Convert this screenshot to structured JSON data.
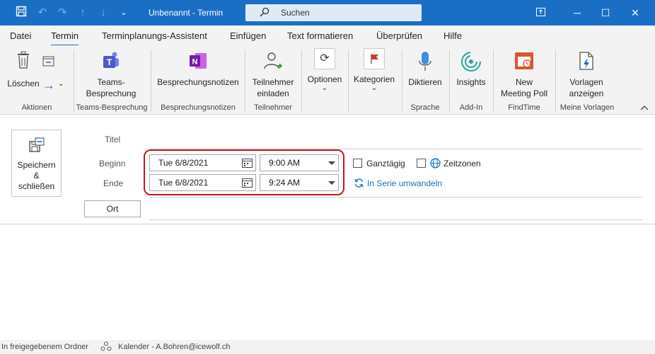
{
  "titlebar": {
    "title": "Unbenannt  -  Termin",
    "search_placeholder": "Suchen"
  },
  "tabs": [
    {
      "label": "Datei"
    },
    {
      "label": "Termin"
    },
    {
      "label": "Terminplanungs-Assistent"
    },
    {
      "label": "Einfügen"
    },
    {
      "label": "Text formatieren"
    },
    {
      "label": "Überprüfen"
    },
    {
      "label": "Hilfe"
    }
  ],
  "ribbon": {
    "buttons": {
      "delete": "Löschen",
      "teams": "Teams-\nBesprechung",
      "notes": "Besprechungsnotizen",
      "attendees": "Teilnehmer\neinladen",
      "options": "Optionen",
      "categories": "Kategorien",
      "dictate": "Diktieren",
      "insights": "Insights",
      "new_poll": "New\nMeeting Poll",
      "templates": "Vorlagen\nanzeigen"
    },
    "groups": {
      "actions": "Aktionen",
      "teams": "Teams-Besprechung",
      "notes": "Besprechungsnotizen",
      "attendees": "Teilnehmer",
      "speech": "Sprache",
      "addin": "Add-In",
      "findtime": "FindTime",
      "templates": "Meine Vorlagen"
    }
  },
  "form": {
    "save_label": "Speichern\n&\nschließen",
    "title_label": "Titel",
    "start_label": "Beginn",
    "end_label": "Ende",
    "start_date": "Tue 6/8/2021",
    "start_time": "9:00 AM",
    "end_date": "Tue 6/8/2021",
    "end_time": "9:24 AM",
    "allday_label": "Ganztägig",
    "timezones_label": "Zeitzonen",
    "recurrence_label": "In Serie umwandeln",
    "location_label": "Ort"
  },
  "status": {
    "folder_text": "In freigegebenem Ordner",
    "calendar_text": "Kalender - A.Bohren@icewolf.ch"
  },
  "colors": {
    "accent": "#1a6fc4",
    "highlight": "#c8161d"
  }
}
